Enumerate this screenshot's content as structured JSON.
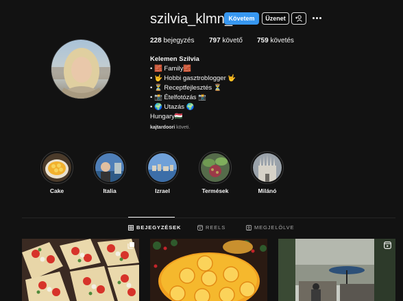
{
  "profile": {
    "username": "szilvia_klmn_",
    "follow_label": "Követem",
    "message_label": "Üzenet",
    "posts_count": "228",
    "posts_label": "bejegyzés",
    "followers_count": "797",
    "followers_label": "követő",
    "following_count": "759",
    "following_label": "követés",
    "full_name": "Kelemen Szilvia",
    "bio_lines": [
      "• 🧱 Family🧱",
      "• 🤟 Hobbi gasztroblogger 🤟",
      "• ⏳ Receptfejlesztés ⏳",
      "• 📸 Ételfotózás 📸",
      "• 🌍 Utazás 🌍",
      "Hungary🇭🇺"
    ],
    "followed_by_user": "kajtardoori",
    "followed_by_suffix": " követi."
  },
  "highlights": [
    {
      "label": "Cake"
    },
    {
      "label": "Italia"
    },
    {
      "label": "Izrael"
    },
    {
      "label": "Termések"
    },
    {
      "label": "Milánó"
    }
  ],
  "tabs": [
    {
      "label": "BEJEGYZÉSEK",
      "icon": "grid-icon",
      "active": true
    },
    {
      "label": "REELS",
      "icon": "reels-icon",
      "active": false
    },
    {
      "label": "MEGJELÖLVE",
      "icon": "tagged-icon",
      "active": false
    }
  ],
  "colors": {
    "background": "#121212",
    "follow_button": "#3797f0",
    "secondary_text": "#a8a8a8"
  }
}
